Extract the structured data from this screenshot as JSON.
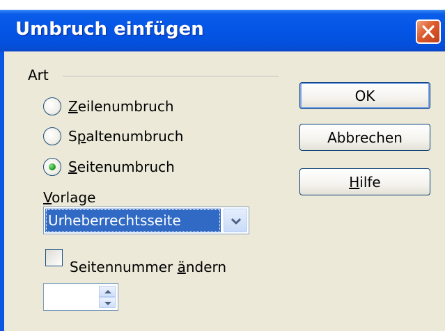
{
  "window": {
    "title": "Umbruch einfügen"
  },
  "art": {
    "group_label": "Art",
    "options": [
      {
        "label": "Zeilenumbruch",
        "selected": false
      },
      {
        "label": "Spaltenumbruch",
        "selected": false
      },
      {
        "label": "Seitenumbruch",
        "selected": true
      }
    ]
  },
  "vorlage": {
    "label": "Vorlage",
    "selected_value": "Urheberrechtsseite"
  },
  "seitennummer": {
    "checkbox_label": "Seitennummer ändern",
    "checked": false,
    "value": ""
  },
  "buttons": {
    "ok": "OK",
    "cancel": "Abbrechen",
    "help": "Hilfe"
  },
  "colors": {
    "titlebar": "#0454e6",
    "client_bg": "#ece9d8",
    "selection": "#316ac5",
    "close_button": "#dc5a2c"
  },
  "icons": {
    "close": "close-x-icon",
    "dropdown": "chevron-down-icon",
    "spin": "spin-up-down-icon"
  }
}
